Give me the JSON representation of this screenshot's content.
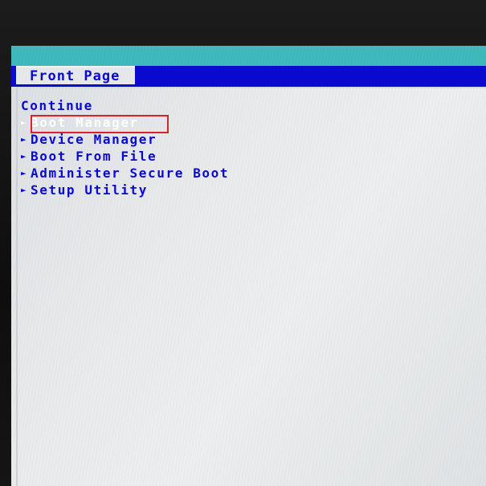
{
  "front_page_tab": {
    "label": "Front Page"
  },
  "menu": {
    "continue_label": "Continue",
    "arrow_glyph": "►",
    "items": [
      {
        "label": "Boot Manager"
      },
      {
        "label": "Device Manager"
      },
      {
        "label": "Boot From File"
      },
      {
        "label": "Administer Secure Boot"
      },
      {
        "label": "Setup Utility"
      }
    ],
    "selected_index": 0
  },
  "colors": {
    "header_cyan": "#3fb9bb",
    "bios_blue": "#0a0ad0",
    "background": "#e8eaec",
    "selected_text": "#ffffff",
    "highlight_box": "#d8232a"
  }
}
